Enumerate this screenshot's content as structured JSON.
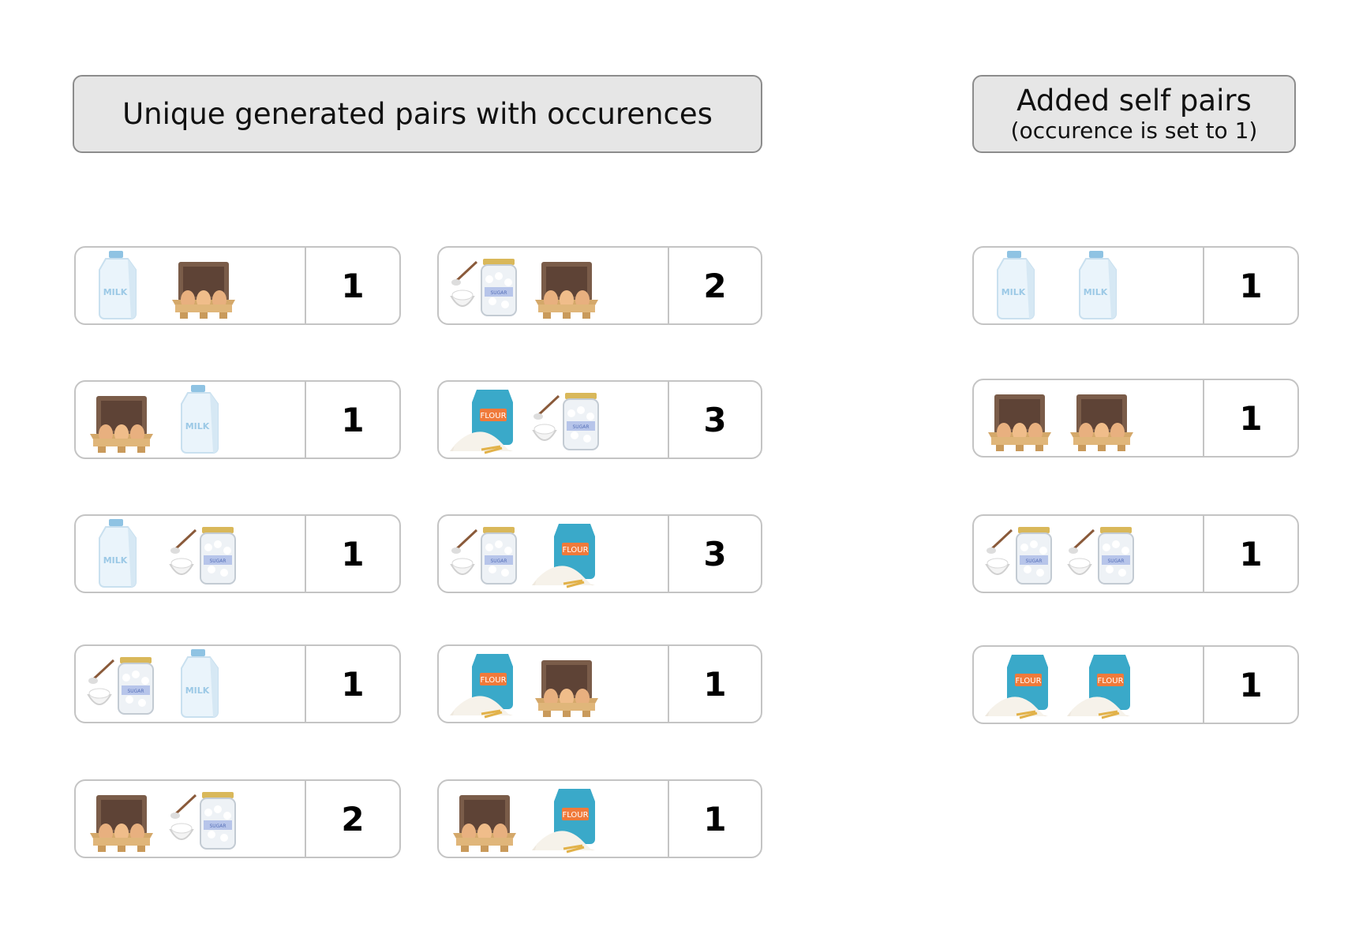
{
  "header_left": {
    "title": "Unique generated pairs with occurences"
  },
  "header_right": {
    "title": "Added self pairs",
    "subtitle": "(occurence is set to 1)"
  },
  "rows_left": [
    {
      "items": [
        "milk",
        "eggs"
      ],
      "count": "1"
    },
    {
      "items": [
        "eggs",
        "milk"
      ],
      "count": "1"
    },
    {
      "items": [
        "milk",
        "sugar"
      ],
      "count": "1"
    },
    {
      "items": [
        "sugar",
        "milk"
      ],
      "count": "1"
    },
    {
      "items": [
        "eggs",
        "sugar"
      ],
      "count": "2"
    }
  ],
  "rows_middle": [
    {
      "items": [
        "sugar",
        "eggs"
      ],
      "count": "2"
    },
    {
      "items": [
        "flour",
        "sugar"
      ],
      "count": "3"
    },
    {
      "items": [
        "sugar",
        "flour"
      ],
      "count": "3"
    },
    {
      "items": [
        "flour",
        "eggs"
      ],
      "count": "1"
    },
    {
      "items": [
        "eggs",
        "flour"
      ],
      "count": "1"
    }
  ],
  "rows_right": [
    {
      "items": [
        "milk",
        "milk"
      ],
      "count": "1"
    },
    {
      "items": [
        "eggs",
        "eggs"
      ],
      "count": "1"
    },
    {
      "items": [
        "sugar",
        "sugar"
      ],
      "count": "1"
    },
    {
      "items": [
        "flour",
        "flour"
      ],
      "count": "1"
    }
  ],
  "item_labels": {
    "milk": "MILK",
    "flour": "FLOUR",
    "sugar": "SUGAR"
  }
}
